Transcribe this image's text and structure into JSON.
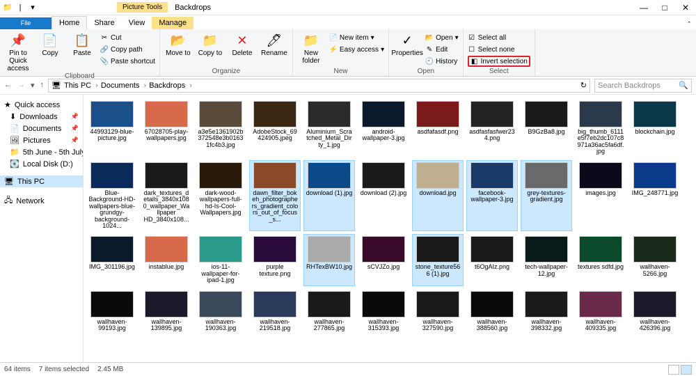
{
  "title": "Backdrops",
  "contextual_tab": "Picture Tools",
  "tabs": {
    "file": "File",
    "home": "Home",
    "share": "Share",
    "view": "View",
    "manage": "Manage"
  },
  "ribbon": {
    "pin": "Pin to Quick access",
    "copy": "Copy",
    "paste": "Paste",
    "cut": "Cut",
    "copy_path": "Copy path",
    "paste_shortcut": "Paste shortcut",
    "move_to": "Move to",
    "copy_to": "Copy to",
    "delete": "Delete",
    "rename": "Rename",
    "new_folder": "New folder",
    "new_item": "New item",
    "easy_access": "Easy access",
    "properties": "Properties",
    "open": "Open",
    "edit": "Edit",
    "history": "History",
    "select_all": "Select all",
    "select_none": "Select none",
    "invert_selection": "Invert selection",
    "groups": {
      "clipboard": "Clipboard",
      "organize": "Organize",
      "new": "New",
      "open": "Open",
      "select": "Select"
    }
  },
  "breadcrumb": [
    "This PC",
    "Documents",
    "Backdrops"
  ],
  "search_placeholder": "Search Backdrops",
  "sidebar": {
    "quick_access": "Quick access",
    "items": [
      "Downloads",
      "Documents",
      "Pictures",
      "5th June - 5th July",
      "Local Disk (D:)"
    ],
    "this_pc": "This PC",
    "network": "Network"
  },
  "files": [
    {
      "n": "44993129-blue-picture.jpg",
      "c": "#1b4f8a",
      "s": 0
    },
    {
      "n": "67028705-play-wallpapers.jpg",
      "c": "#d66a4a",
      "s": 0
    },
    {
      "n": "a3e5e1361902b372548e3b01631fc4b3.jpg",
      "c": "#5a4a3a",
      "s": 0
    },
    {
      "n": "AdobeStock_69424905.jpeg",
      "c": "#3a2814",
      "s": 0
    },
    {
      "n": "Aluminium_Scratched_Metal_Dirty_1.jpg",
      "c": "#2a2a2a",
      "s": 0
    },
    {
      "n": "android-wallpaper-3.jpg",
      "c": "#0a1a2a",
      "s": 0
    },
    {
      "n": "asdfafasdf.png",
      "c": "#7a1a1a",
      "s": 0
    },
    {
      "n": "asdfasfasfwer234.png",
      "c": "#222222",
      "s": 0
    },
    {
      "n": "B9GzBa8.jpg",
      "c": "#1a1a1a",
      "s": 0
    },
    {
      "n": "big_thumb_6111e5f7eb2dc107c8971a36ac5fa6df.jpg",
      "c": "#2a3a4a",
      "s": 0
    },
    {
      "n": "blockchain.jpg",
      "c": "#0a3a4a",
      "s": 0
    },
    {
      "n": "Blue-Background-HD-wallpapers-blue-grundgy-background-1024...",
      "c": "#0a2a5a",
      "s": 0
    },
    {
      "n": "dark_textures_details_3840x1080_wallpaper_Wallpaper HD_3840x108...",
      "c": "#1a1a1a",
      "s": 0
    },
    {
      "n": "dark-wood-wallpapers-full-hd-Is-Cool-Wallpapers.jpg",
      "c": "#2a1a0a",
      "s": 0
    },
    {
      "n": "dawn_filter_bokeh_photographers_gradient_colors_out_of_focus_s...",
      "c": "#8a4a2a",
      "s": 1
    },
    {
      "n": "download (1).jpg",
      "c": "#0a4a8a",
      "s": 1
    },
    {
      "n": "download (2).jpg",
      "c": "#1a1a1a",
      "s": 0
    },
    {
      "n": "download.jpg",
      "c": "#c0b090",
      "s": 1
    },
    {
      "n": "facebook-wallpaper-3.jpg",
      "c": "#1a3a6a",
      "s": 1
    },
    {
      "n": "grey-textures-gradient.jpg",
      "c": "#6a6a6a",
      "s": 1
    },
    {
      "n": "images.jpg",
      "c": "#0a0a1a",
      "s": 0
    },
    {
      "n": "IMG_248771.jpg",
      "c": "#0a3a8a",
      "s": 0
    },
    {
      "n": "IMG_301196.jpg",
      "c": "#0a1a2a",
      "s": 0
    },
    {
      "n": "instablue.jpg",
      "c": "#d66a4a",
      "s": 0
    },
    {
      "n": "ios-11-wallpaper-for-ipad-1.jpg",
      "c": "#2a9a8a",
      "s": 0
    },
    {
      "n": "purple texture.png",
      "c": "#2a0a3a",
      "s": 0
    },
    {
      "n": "RHTexBW10.jpg",
      "c": "#aaaaaa",
      "s": 1
    },
    {
      "n": "sCVJZo.jpg",
      "c": "#3a0a2a",
      "s": 0
    },
    {
      "n": "stone_texture566 (1).jpg",
      "c": "#1a1a1a",
      "s": 1
    },
    {
      "n": "t6OgAIz.png",
      "c": "#1a1a1a",
      "s": 0
    },
    {
      "n": "tech-wallpaper-12.jpg",
      "c": "#0a1a1a",
      "s": 0
    },
    {
      "n": "textures sdfd.jpg",
      "c": "#0a4a2a",
      "s": 0
    },
    {
      "n": "wallhaven-5266.jpg",
      "c": "#1a2a1a",
      "s": 0
    },
    {
      "n": "wallhaven-99193.jpg",
      "c": "#0a0a0a",
      "s": 0
    },
    {
      "n": "wallhaven-139895.jpg",
      "c": "#1a1a2a",
      "s": 0
    },
    {
      "n": "wallhaven-190363.jpg",
      "c": "#3a4a5a",
      "s": 0
    },
    {
      "n": "wallhaven-219518.jpg",
      "c": "#2a3a5a",
      "s": 0
    },
    {
      "n": "wallhaven-277865.jpg",
      "c": "#1a1a1a",
      "s": 0
    },
    {
      "n": "wallhaven-315393.jpg",
      "c": "#0a0a0a",
      "s": 0
    },
    {
      "n": "wallhaven-327590.jpg",
      "c": "#1a1a1a",
      "s": 0
    },
    {
      "n": "wallhaven-388560.jpg",
      "c": "#0a0a0a",
      "s": 0
    },
    {
      "n": "wallhaven-398332.jpg",
      "c": "#1a1a1a",
      "s": 0
    },
    {
      "n": "wallhaven-409335.jpg",
      "c": "#6a2a4a",
      "s": 0
    },
    {
      "n": "wallhaven-426396.jpg",
      "c": "#1a1a2a",
      "s": 0
    }
  ],
  "status": {
    "count": "64 items",
    "selected": "7 items selected",
    "size": "2.45 MB"
  }
}
